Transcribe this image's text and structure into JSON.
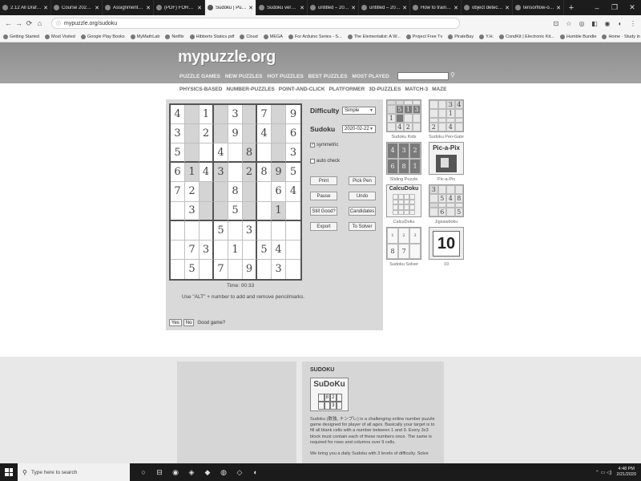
{
  "browser": {
    "tabs": [
      {
        "title": "2.12 All Draft – Out",
        "active": false
      },
      {
        "title": "Course 2020D1 lo",
        "active": false
      },
      {
        "title": "Assignment3.pdf",
        "active": false
      },
      {
        "title": "(PDF) FORECASTI",
        "active": false
      },
      {
        "title": "Sudoku | Puzzle G",
        "active": true
      },
      {
        "title": "Sudoku very diffi",
        "active": false
      },
      {
        "title": "untitled – 2020030",
        "active": false
      },
      {
        "title": "untitled – 2020030",
        "active": false
      },
      {
        "title": "How to train an o",
        "active": false
      },
      {
        "title": "object detection",
        "active": false
      },
      {
        "title": "tensorflow-obje",
        "active": false
      }
    ],
    "new_tab": "+",
    "window_controls": {
      "minimize": "–",
      "restore": "❐",
      "close": "✕"
    },
    "nav": {
      "back": "←",
      "forward": "→",
      "reload": "⟳",
      "home": "⌂"
    },
    "url": "mypuzzle.org/sudoku",
    "lock_icon": "ⓘ",
    "omni_icons": [
      "⊡",
      "☆",
      "◎",
      "◧",
      "◉",
      "◐",
      "⋮"
    ],
    "bookmarks": [
      "Getting Started",
      "Most Visited",
      "Google Play Books",
      "MyMathLab",
      "Netflix",
      "Hibberts Statics.pdf",
      "Cloud",
      "MEGA",
      "For Arduino Series - S...",
      "The Elementalist: A W...",
      "Project Free Tv",
      "PirateBay",
      "Y.H.",
      "CondKit | Electronic Kit...",
      "Humble Bundle",
      "Home · Study in Germ..."
    ]
  },
  "site": {
    "logo": "mypuzzle.org",
    "nav": [
      "PUZZLE GAMES",
      "NEW PUZZLES",
      "HOT PUZZLES",
      "BEST PUZZLES",
      "MOST PLAYED"
    ],
    "search_icon": "⚲",
    "subnav": [
      "PHYSICS-BASED",
      "NUMBER-PUZZLES",
      "POINT-AND-CLICK",
      "PLATFORMER",
      "3D-PUZZLES",
      "MATCH-3",
      "MAZE"
    ]
  },
  "game": {
    "board": [
      [
        "4",
        "",
        "1",
        "",
        "3",
        "",
        "7",
        "",
        "9"
      ],
      [
        "3",
        "",
        "2",
        "",
        "9",
        "",
        "4",
        "",
        "6"
      ],
      [
        "5",
        "",
        "",
        "4",
        "",
        "8",
        "",
        "",
        "3"
      ],
      [
        "6",
        "1",
        "4",
        "3",
        "",
        "2",
        "8",
        "9",
        "5"
      ],
      [
        "7",
        "2",
        "",
        "",
        "8",
        "",
        "",
        "6",
        "4"
      ],
      [
        "",
        "3",
        "",
        "",
        "5",
        "",
        "",
        "1",
        ""
      ],
      [
        "",
        "",
        "",
        "5",
        "",
        "3",
        "",
        "",
        ""
      ],
      [
        "",
        "7",
        "3",
        "",
        "1",
        "",
        "5",
        "4",
        ""
      ],
      [
        "",
        "5",
        "",
        "7",
        "",
        "9",
        "",
        "3",
        ""
      ]
    ],
    "timer": "Time: 00:33",
    "hint": "Use \"ALT\" + number to add and remove pencilmarks.",
    "yes_label": "Yes",
    "no_label": "No",
    "good_game": "Good game?",
    "difficulty_label": "Difficulty",
    "difficulty_value": "Simple",
    "sudoku_label": "Sudoku",
    "sudoku_value": "2020-02-22",
    "symmetric_label": "symmetric",
    "symmetric_checked": "✓",
    "autocheck_label": "auto check",
    "autocheck_checked": "",
    "buttons": {
      "print": "Print",
      "pick_pen": "Pick Pen",
      "pause": "Pause",
      "undo": "Undo",
      "still_good": "Still Good?",
      "candidates": "Candidates",
      "export": "Export",
      "to_solver": "To Solver"
    }
  },
  "related": [
    {
      "caption": "Sudoku Kids"
    },
    {
      "caption": "Sudoku Pen-Gate"
    },
    {
      "caption": "Sliding Puzzle"
    },
    {
      "caption": "Pic-a-Pix",
      "label": "Pic-a-Pix"
    },
    {
      "caption": "CalcuDoku",
      "label": "CalcuDoku"
    },
    {
      "caption": "Jigsawdoku"
    },
    {
      "caption": "Sudoku Solver"
    },
    {
      "caption": "10",
      "label": "10"
    }
  ],
  "info": {
    "title": "SUDOKU",
    "logo_text": "SuDoKu",
    "logo_grid": [
      "",
      "8",
      "2",
      "",
      "",
      "",
      "3",
      ""
    ],
    "text": "Sudoku (数独, ナンプレ) is a challenging online number puzzle game designed for player of all ages. Basically your target is to fill all blank cells with a number between 1 and 9. Every 3x3 block must contain each of these numbers once. The same is required for rows and columns over 9 cells.",
    "text2": "We bring you a daily Sudoku with 3 levels of difficulty. Solve"
  },
  "taskbar": {
    "search_placeholder": "Type here to search",
    "search_icon": "⚲",
    "icons": [
      "○",
      "⊟",
      "◉",
      "◈",
      "◆",
      "◍",
      "◇",
      "◐"
    ],
    "tray": "⌃  ▭  ◁)",
    "time": "4:48 PM",
    "date": "2/21/2020"
  }
}
